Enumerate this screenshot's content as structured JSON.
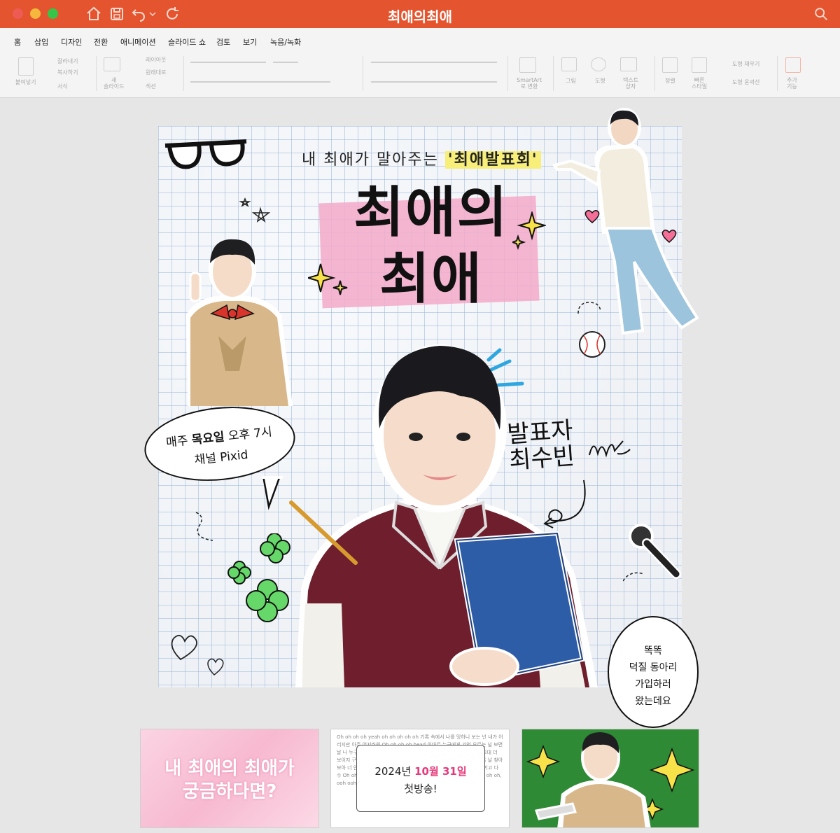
{
  "app": {
    "window_title": "최애의최애",
    "quick_access": [
      "home-icon",
      "save-icon",
      "undo-icon",
      "undo-dropdown-icon",
      "redo-icon"
    ]
  },
  "ribbon": {
    "tabs": [
      "홈",
      "삽입",
      "디자인",
      "전환",
      "애니메이션",
      "슬라이드 쇼",
      "검토",
      "보기",
      "녹음/녹화"
    ],
    "active_tab": "홈",
    "clipboard": {
      "paste": "붙여넣기",
      "cut": "잘라내기",
      "copy": "복사하기",
      "format": "서식"
    },
    "slides": {
      "new_slide": "새\n슬라이드",
      "layout": "레이아웃",
      "reset": "원래대로",
      "section": "섹션"
    },
    "drawing": {
      "smartart": "SmartArt\n로 변환",
      "picture": "그림",
      "shape": "도형",
      "textbox": "텍스트\n상자",
      "arrange": "정렬",
      "quick_styles": "빠른\n스타일",
      "shape_fill": "도형 채우기",
      "shape_outline": "도형 윤곽선",
      "addins": "추가\n기능"
    }
  },
  "slide": {
    "headline_pre": "내 최애가 말아주는 ",
    "headline_highlight": "'최애발표회'",
    "title_line1": "최애의",
    "title_line2": "최애",
    "schedule_bubble": {
      "line1_pre": "매주 ",
      "line1_bold": "목요일",
      "line1_post": " 오후 7시",
      "line2": "채널 Pixid"
    },
    "presenter_line1": "발표자",
    "presenter_line2": "최수빈",
    "knock_bubble": [
      "똑똑",
      "덕질 동아리",
      "가입하러",
      "왔는데요"
    ]
  },
  "thumbnails": {
    "thumb1": [
      "내 최애의 최애가",
      "궁금하다면?"
    ],
    "thumb2": {
      "bg_text": "Oh oh oh oh yeah oh oh oh oh oh 기록 속에서 나를 멍하니 보는 넌 내가 어리지만 아주 어지러워 Oh oh oh oh head 이대로 누구에게 기억 오르는 널 보면 날 나 누구 ! 더 미리 깨 다 버리고 한 거야 나 내 더리면 의해 마 보이고 그대 더 보이지 구해봐 아니 미래 눈을 떠 보아 나 아니 바리지 말고 짧게 흐르도록 날 찾아 보아 너 안에 내 모든 거 우리 완벽한 아이 누구 나 저 별이 되어 나 다 지키고 다 수 Oh oh oh oh oh oh oh oh oh oh ooh, ya ya ya Oh oh oh oh oh oh, ooh ooh ooh, ya ya ya",
      "date_pre": "2024년 ",
      "date_pink": "10월 31일",
      "line2": "첫방송!"
    }
  },
  "colors": {
    "title_bar": "#e4552f",
    "accent_pink": "#e6397a",
    "thumb3_green": "#2e8a34"
  }
}
